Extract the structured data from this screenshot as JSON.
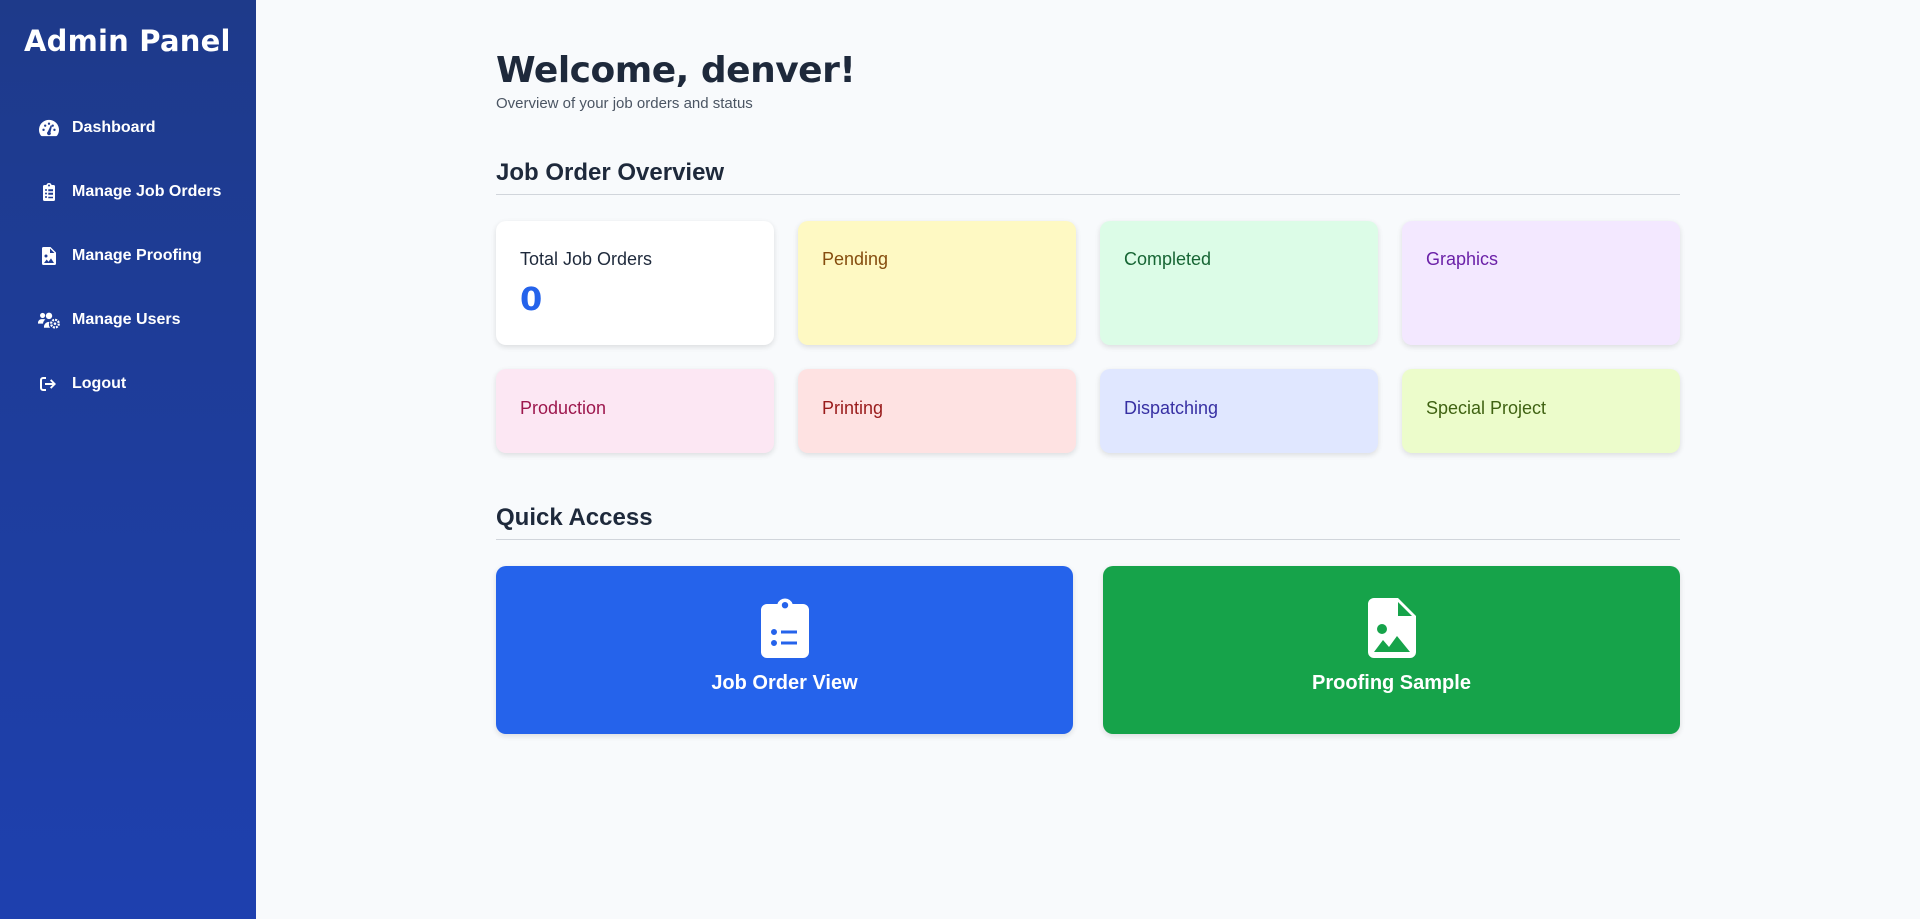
{
  "sidebar": {
    "brand": "Admin Panel",
    "items": [
      {
        "label": "Dashboard",
        "icon": "gauge-icon"
      },
      {
        "label": "Manage Job Orders",
        "icon": "clipboard-list-icon"
      },
      {
        "label": "Manage Proofing",
        "icon": "file-image-icon"
      },
      {
        "label": "Manage Users",
        "icon": "users-cog-icon"
      },
      {
        "label": "Logout",
        "icon": "sign-out-icon"
      }
    ],
    "colors": {
      "top": "#1e3a8a",
      "bottom": "#1e40af"
    }
  },
  "header": {
    "welcome": "Welcome, denver!",
    "subtitle": "Overview of your job orders and status"
  },
  "overview": {
    "title": "Job Order Overview",
    "cards": [
      {
        "label": "Total Job Orders",
        "value": "0",
        "bg": "#ffffff",
        "color": "#1e293b"
      },
      {
        "label": "Pending",
        "bg": "#fef9c3",
        "color": "#854d0e"
      },
      {
        "label": "Completed",
        "bg": "#dcfce7",
        "color": "#166534"
      },
      {
        "label": "Graphics",
        "bg": "#f3e8ff",
        "color": "#6b21a8"
      },
      {
        "label": "Production",
        "bg": "#fce7f3",
        "color": "#9d174d"
      },
      {
        "label": "Printing",
        "bg": "#fee2e2",
        "color": "#991b1b"
      },
      {
        "label": "Dispatching",
        "bg": "#e0e7ff",
        "color": "#3730a3"
      },
      {
        "label": "Special Project",
        "bg": "#ecfccb",
        "color": "#3f6212"
      }
    ]
  },
  "quick_access": {
    "title": "Quick Access",
    "buttons": [
      {
        "label": "Job Order View",
        "icon": "clipboard-list-icon",
        "bg": "#2563eb"
      },
      {
        "label": "Proofing Sample",
        "icon": "file-image-icon",
        "bg": "#16a34a"
      }
    ]
  }
}
